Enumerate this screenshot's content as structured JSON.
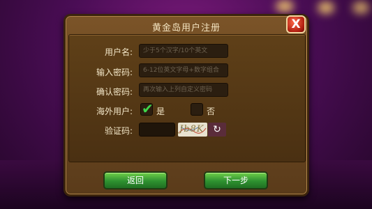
{
  "dialog": {
    "title": "黄金岛用户注册",
    "close_label": "X"
  },
  "form": {
    "username_label": "用户名:",
    "username_placeholder": "少于5个汉字/10个英文",
    "password_label": "输入密码:",
    "password_placeholder": "6-12位英文字母+数字组合",
    "confirm_label": "确认密码:",
    "confirm_placeholder": "再次输入上列自定义密码",
    "overseas_label": "海外用户:",
    "overseas_yes_label": "是",
    "overseas_no_label": "否",
    "overseas_checked": "yes",
    "captcha_label": "验证码:",
    "captcha_image_text": "Jb8K",
    "refresh_icon": "↻"
  },
  "buttons": {
    "back_label": "返回",
    "next_label": "下一步"
  },
  "colors": {
    "dialog_bg": "#6b4820",
    "button_green": "#2e9130",
    "close_red": "#b01e10"
  }
}
